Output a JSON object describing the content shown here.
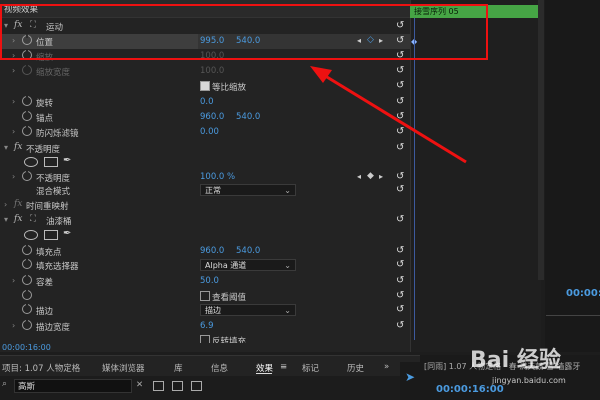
{
  "effect_controls": {
    "header": "视频效果",
    "motion": {
      "label": "运动",
      "position": {
        "label": "位置",
        "x": "995.0",
        "y": "540.0"
      },
      "scale": {
        "label": "缩放",
        "value": "100.0"
      },
      "scale_width": {
        "label": "缩放宽度",
        "value": "100.0"
      },
      "uniform_scale": "等比缩放",
      "rotation": {
        "label": "旋转",
        "value": "0.0"
      },
      "anchor": {
        "label": "锚点",
        "x": "960.0",
        "y": "540.0"
      },
      "anti_flicker": {
        "label": "防闪烁滤镜",
        "value": "0.00"
      }
    },
    "opacity": {
      "label": "不透明度",
      "opacity": {
        "label": "不透明度",
        "value": "100.0 %"
      },
      "blend_mode": {
        "label": "混合模式",
        "value": "正常"
      }
    },
    "time_remap": {
      "label": "时间重映射"
    },
    "paint_bucket": {
      "label": "油漆桶",
      "fill_point": {
        "label": "填充点",
        "x": "960.0",
        "y": "540.0"
      },
      "fill_selector": {
        "label": "填充选择器",
        "value": "Alpha 通道"
      },
      "tolerance": {
        "label": "容差",
        "value": "50.0"
      },
      "view_threshold": "查看阈值",
      "stroke": {
        "label": "描边",
        "value": "描边"
      },
      "stroke_width": {
        "label": "描边宽度",
        "value": "6.9"
      },
      "invert": "反转填充"
    }
  },
  "timeline": {
    "sequence_label": "接雪序列 05"
  },
  "timecode_bottom": "00:00:16:00",
  "right_panel_timecode": "00:00:",
  "tabs": [
    {
      "label": "项目: 1.07 人物定格"
    },
    {
      "label": "媒体浏览器"
    },
    {
      "label": "库"
    },
    {
      "label": "信息"
    },
    {
      "label": "效果"
    },
    {
      "label": "标记"
    },
    {
      "label": "历史"
    }
  ],
  "tabs_overflow": "»",
  "search": {
    "value": "高斯"
  },
  "program": {
    "title": "[同雨] 1.07 人物定格 · 春 满天鼓 雪  墙露牙",
    "timecode": "00:00:16:00"
  },
  "watermark": {
    "text": "Bai 经验",
    "sub": "jingyan.baidu.com"
  },
  "colors": {
    "accent_blue": "#4b9be0",
    "annotation_red": "#e11111",
    "sequence_green": "#46a545"
  }
}
